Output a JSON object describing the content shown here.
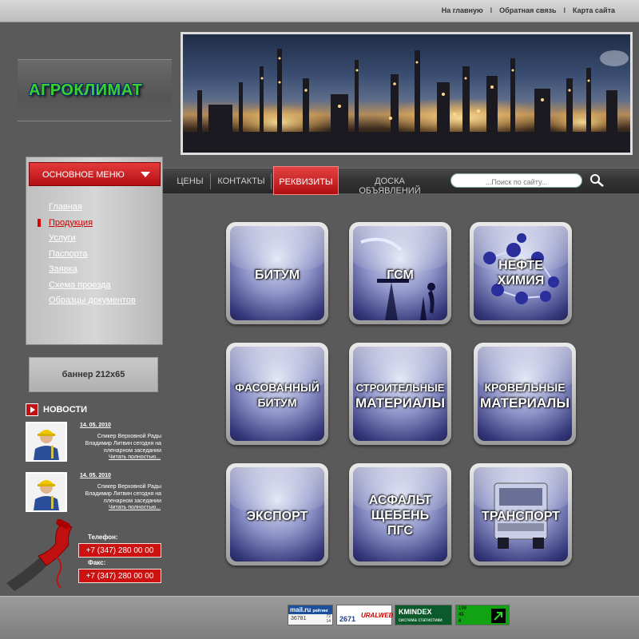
{
  "top_links": [
    "На главную",
    "Обратная связь",
    "Карта сайта"
  ],
  "logo": {
    "text": "АГРОКЛИМАТ"
  },
  "menu": {
    "title": "ОСНОВНОЕ МЕНЮ",
    "items": [
      "Главная",
      "Продукция",
      "Услуги",
      "Паспорта",
      "Заявка",
      "Схема проезда",
      "Образцы документов"
    ],
    "active_index": 1
  },
  "nav": {
    "items": [
      "ЦЕНЫ",
      "КОНТАКТЫ",
      "РЕКВИЗИТЫ",
      "ДОСКА ОБЪЯВЛЕНИЙ"
    ],
    "active": "РЕКВИЗИТЫ"
  },
  "search": {
    "placeholder": "...Поиск по сайту..."
  },
  "banner": {
    "text": "баннер 212х65"
  },
  "news": {
    "title": "НОВОСТИ",
    "items": [
      {
        "date": "14. 05. 2010",
        "text": "Спикер Верховной Рады Владимир Литвин сегодня на пленарном заседании",
        "more": "Читать полностью..."
      },
      {
        "date": "14. 05. 2010",
        "text": "Спикер Верховной Рады Владимир Литвин сегодня на пленарном заседании",
        "more": "Читать полностью..."
      }
    ]
  },
  "contacts": {
    "phone_label": "Телефон:",
    "phone": "+7 (347) 280 00 00",
    "fax_label": "Факс:",
    "fax": "+7 (347) 280 00 00"
  },
  "tiles": [
    {
      "name": "bitum",
      "lines": [
        "БИТУМ"
      ]
    },
    {
      "name": "gsm",
      "lines": [
        "ГСМ"
      ]
    },
    {
      "name": "neftekhimiya",
      "lines": [
        "НЕФТЕ",
        "ХИМИЯ"
      ]
    },
    {
      "name": "fasovanny-bitum",
      "lines": [
        "ФАСОВАННЫЙ",
        "БИТУМ"
      ]
    },
    {
      "name": "stroitelnye-materialy",
      "lines": [
        "СТРОИТЕЛЬНЫЕ",
        "МАТЕРИАЛЫ"
      ]
    },
    {
      "name": "krovelnye-materialy",
      "lines": [
        "КРОВЕЛЬНЫЕ",
        "МАТЕРИАЛЫ"
      ]
    },
    {
      "name": "eksport",
      "lines": [
        "ЭКСПОРТ"
      ]
    },
    {
      "name": "asfalt-shcheben-pgs",
      "lines": [
        "АСФАЛЬТ",
        "ЩЕБЕНЬ",
        "ПГС"
      ]
    },
    {
      "name": "transport",
      "lines": [
        "ТРАНСПОРТ"
      ]
    }
  ],
  "counters": {
    "mailru": {
      "logo": "mail.ru",
      "sub": "рейтинг",
      "value": "36781",
      "small": [
        "72",
        "14"
      ]
    },
    "uralweb": {
      "value": "2671",
      "logo": "URALWEB"
    },
    "kmindex": {
      "logo": "KMINDEX",
      "sub": "система статистики"
    },
    "liveinternet": {
      "lines": [
        "199",
        "45",
        "6"
      ]
    }
  },
  "colors": {
    "accent": "#c31015",
    "background": "#5a5a5a",
    "logo": "#3bd02e"
  }
}
